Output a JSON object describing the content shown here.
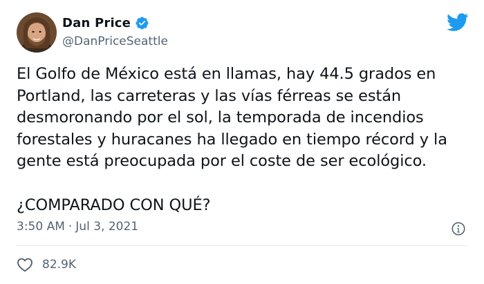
{
  "author": {
    "display_name": "Dan Price",
    "handle": "@DanPriceSeattle",
    "verified": true
  },
  "tweet": {
    "lines_paragraph_1": [
      "El Golfo de México está en llamas, hay 44.5 grados en",
      "Portland, las carreteras y las vías férreas se están",
      "desmoronando por el sol, la temporada de incendios",
      "forestales y huracanes ha llegado en tiempo récord y la",
      "gente está preocupada por el coste de ser ecológico."
    ],
    "paragraph_2": "¿COMPARADO CON QUÉ?",
    "time": "3:50 AM",
    "separator": "·",
    "date": "Jul 3, 2021"
  },
  "engagement": {
    "likes": "82.9K"
  },
  "colors": {
    "twitter_blue": "#1d9bf0",
    "text_primary": "#0f1419",
    "text_secondary": "#536471",
    "divider": "#e4e9ec"
  },
  "icons": {
    "verified": "verified-badge-icon",
    "brand": "twitter-bird-icon",
    "info": "info-icon",
    "like": "heart-icon"
  }
}
